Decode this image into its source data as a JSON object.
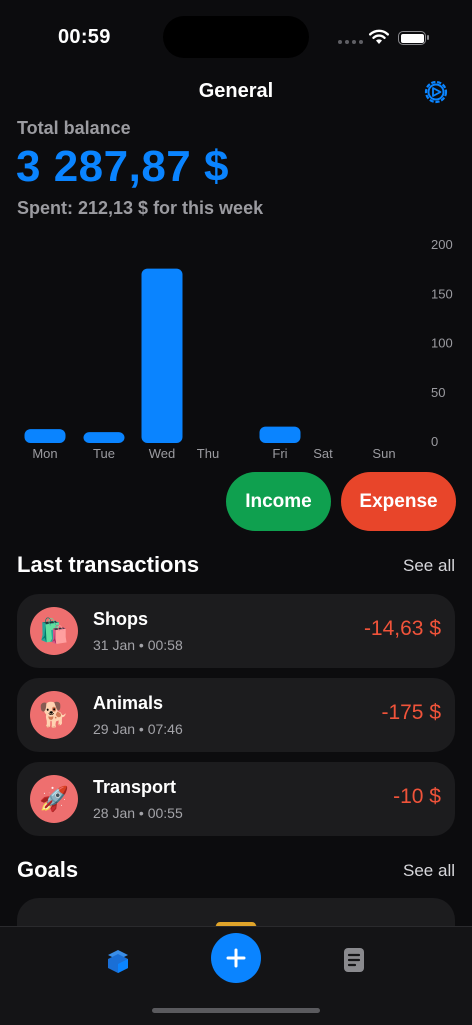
{
  "status": {
    "time": "00:59"
  },
  "header": {
    "title": "General"
  },
  "balance": {
    "label": "Total balance",
    "value": "3 287,87 $",
    "spent": "Spent: 212,13 $ for this week"
  },
  "chart_data": {
    "type": "bar",
    "categories": [
      "Mon",
      "Tue",
      "Wed",
      "Thu",
      "Fri",
      "Sat",
      "Sun"
    ],
    "values": [
      12,
      9,
      175,
      0,
      14.6,
      0,
      0
    ],
    "ylim": [
      0,
      200
    ],
    "yticks": [
      "200",
      "150",
      "100",
      "50",
      "0"
    ],
    "bar_color": "#0a84ff",
    "grid": false
  },
  "actions": {
    "income": "Income",
    "expense": "Expense"
  },
  "transactions": {
    "title": "Last transactions",
    "see_all": "See all",
    "items": [
      {
        "name": "Shops",
        "date": "31 Jan • 00:58",
        "amount": "-14,63 $",
        "icon": "🛍️"
      },
      {
        "name": "Animals",
        "date": "29 Jan • 07:46",
        "amount": "-175 $",
        "icon": "🐕"
      },
      {
        "name": "Transport",
        "date": "28 Jan • 00:55",
        "amount": "-10 $",
        "icon": "🚀"
      }
    ]
  },
  "goals": {
    "title": "Goals",
    "see_all": "See all"
  },
  "colors": {
    "accent": "#0a84ff",
    "income": "#0fa04f",
    "expense": "#e8452a",
    "negative": "#f0533a"
  }
}
